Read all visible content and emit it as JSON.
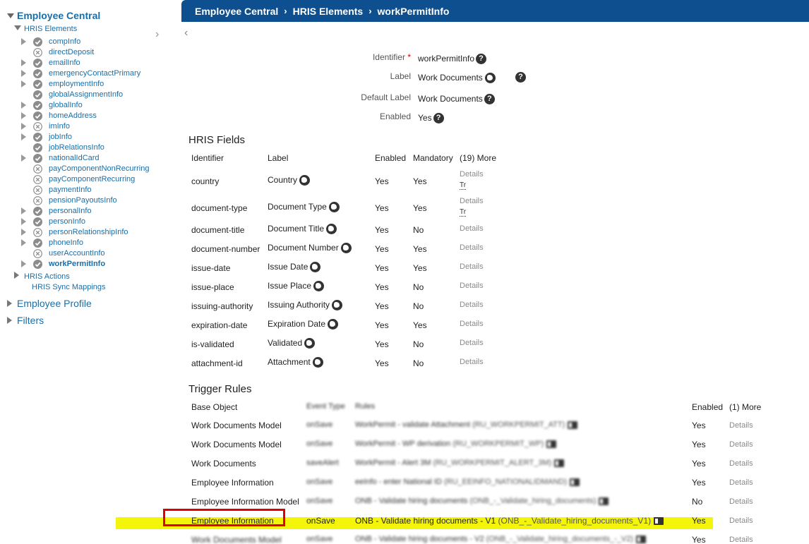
{
  "header": {
    "crumbs": [
      "Employee Central",
      "HRIS Elements",
      "workPermitInfo"
    ]
  },
  "sidebar": {
    "root": "Employee Central",
    "sub": "HRIS Elements",
    "items": [
      {
        "label": "compInfo",
        "tri": true,
        "status": "check"
      },
      {
        "label": "directDeposit",
        "tri": false,
        "status": "x"
      },
      {
        "label": "emailInfo",
        "tri": true,
        "status": "check"
      },
      {
        "label": "emergencyContactPrimary",
        "tri": true,
        "status": "check"
      },
      {
        "label": "employmentInfo",
        "tri": true,
        "status": "check"
      },
      {
        "label": "globalAssignmentInfo",
        "tri": false,
        "status": "check"
      },
      {
        "label": "globalInfo",
        "tri": true,
        "status": "check"
      },
      {
        "label": "homeAddress",
        "tri": true,
        "status": "check"
      },
      {
        "label": "imInfo",
        "tri": true,
        "status": "x"
      },
      {
        "label": "jobInfo",
        "tri": true,
        "status": "check"
      },
      {
        "label": "jobRelationsInfo",
        "tri": false,
        "status": "check"
      },
      {
        "label": "nationalIdCard",
        "tri": true,
        "status": "check"
      },
      {
        "label": "payComponentNonRecurring",
        "tri": false,
        "status": "x"
      },
      {
        "label": "payComponentRecurring",
        "tri": false,
        "status": "x"
      },
      {
        "label": "paymentInfo",
        "tri": false,
        "status": "x"
      },
      {
        "label": "pensionPayoutsInfo",
        "tri": false,
        "status": "x"
      },
      {
        "label": "personalInfo",
        "tri": true,
        "status": "check"
      },
      {
        "label": "personInfo",
        "tri": true,
        "status": "check"
      },
      {
        "label": "personRelationshipInfo",
        "tri": true,
        "status": "x"
      },
      {
        "label": "phoneInfo",
        "tri": true,
        "status": "check"
      },
      {
        "label": "userAccountInfo",
        "tri": false,
        "status": "x"
      },
      {
        "label": "workPermitInfo",
        "tri": true,
        "status": "check",
        "active": true
      }
    ],
    "after_sub": [
      "HRIS Actions",
      "HRIS Sync Mappings"
    ],
    "roots": [
      "Employee Profile",
      "Filters"
    ]
  },
  "properties": {
    "identifier_label": "Identifier",
    "identifier_req": "*",
    "identifier_value": "workPermitInfo",
    "label_label": "Label",
    "label_value": "Work Documents",
    "default_label_label": "Default Label",
    "default_label_value": "Work Documents",
    "enabled_label": "Enabled",
    "enabled_value": "Yes"
  },
  "hris_fields": {
    "title": "HRIS Fields",
    "headers": {
      "identifier": "Identifier",
      "label": "Label",
      "enabled": "Enabled",
      "mandatory": "Mandatory",
      "more": "(19) More"
    },
    "rows": [
      {
        "id": "country",
        "label": "Country",
        "enabled": "Yes",
        "mandatory": "Yes",
        "details": "Details",
        "tr": "Tr"
      },
      {
        "id": "document-type",
        "label": "Document Type",
        "enabled": "Yes",
        "mandatory": "Yes",
        "details": "Details",
        "tr": "Tr"
      },
      {
        "id": "document-title",
        "label": "Document Title",
        "enabled": "Yes",
        "mandatory": "No",
        "details": "Details"
      },
      {
        "id": "document-number",
        "label": "Document Number",
        "enabled": "Yes",
        "mandatory": "Yes",
        "details": "Details"
      },
      {
        "id": "issue-date",
        "label": "Issue Date",
        "enabled": "Yes",
        "mandatory": "Yes",
        "details": "Details"
      },
      {
        "id": "issue-place",
        "label": "Issue Place",
        "enabled": "Yes",
        "mandatory": "No",
        "details": "Details"
      },
      {
        "id": "issuing-authority",
        "label": "Issuing Authority",
        "enabled": "Yes",
        "mandatory": "No",
        "details": "Details"
      },
      {
        "id": "expiration-date",
        "label": "Expiration Date",
        "enabled": "Yes",
        "mandatory": "Yes",
        "details": "Details"
      },
      {
        "id": "is-validated",
        "label": "Validated",
        "enabled": "Yes",
        "mandatory": "No",
        "details": "Details"
      },
      {
        "id": "attachment-id",
        "label": "Attachment",
        "enabled": "Yes",
        "mandatory": "No",
        "details": "Details"
      }
    ]
  },
  "trigger_rules": {
    "title": "Trigger Rules",
    "headers": {
      "base": "Base Object",
      "event": "Event Type",
      "rules": "Rules",
      "enabled": "Enabled",
      "more": "(1) More"
    },
    "rows": [
      {
        "base": "Work Documents Model",
        "event": "onSave",
        "rule": "WorkPermit - validate Attachment",
        "rule_id": "(RU_WORKPERMIT_ATT)",
        "enabled": "Yes",
        "details": "Details",
        "blur": true
      },
      {
        "base": "Work Documents Model",
        "event": "onSave",
        "rule": "WorkPermit - WP derivation",
        "rule_id": "(RU_WORKPERMIT_WP)",
        "enabled": "Yes",
        "details": "Details",
        "blur": true
      },
      {
        "base": "Work Documents",
        "event": "saveAlert",
        "rule": "WorkPermit - Alert 3M",
        "rule_id": "(RU_WORKPERMIT_ALERT_3M)",
        "enabled": "Yes",
        "details": "Details",
        "blur": true
      },
      {
        "base": "Employee Information",
        "event": "onSave",
        "rule": "eeInfo - enter National ID",
        "rule_id": "(RU_EEINFO_NATIONALIDMAND)",
        "enabled": "Yes",
        "details": "Details",
        "blur": true
      },
      {
        "base": "Employee Information Model",
        "event": "onSave",
        "rule": "ONB - Validate hiring documents",
        "rule_id": "(ONB_-_Validate_hiring_documents)",
        "enabled": "No",
        "details": "Details",
        "blur": true
      },
      {
        "base": "Employee Information",
        "event": "onSave",
        "rule": "ONB - Validate hiring documents - V1",
        "rule_id": "(ONB_-_Validate_hiring_documents_V1)",
        "enabled": "Yes",
        "details": "Details",
        "blur": false,
        "highlight": true
      },
      {
        "base": "Work Documents Model",
        "event": "onSave",
        "rule": "ONB - Validate hiring documents - V2",
        "rule_id": "(ONB_-_Validate_hiring_documents_-_V2)",
        "enabled": "Yes",
        "details": "Details",
        "blur": true
      }
    ]
  },
  "colors": {
    "header_bg": "#0e4f8f",
    "link": "#1a6ea8",
    "highlight": "#f5f50a",
    "annotation": "#e00000"
  }
}
